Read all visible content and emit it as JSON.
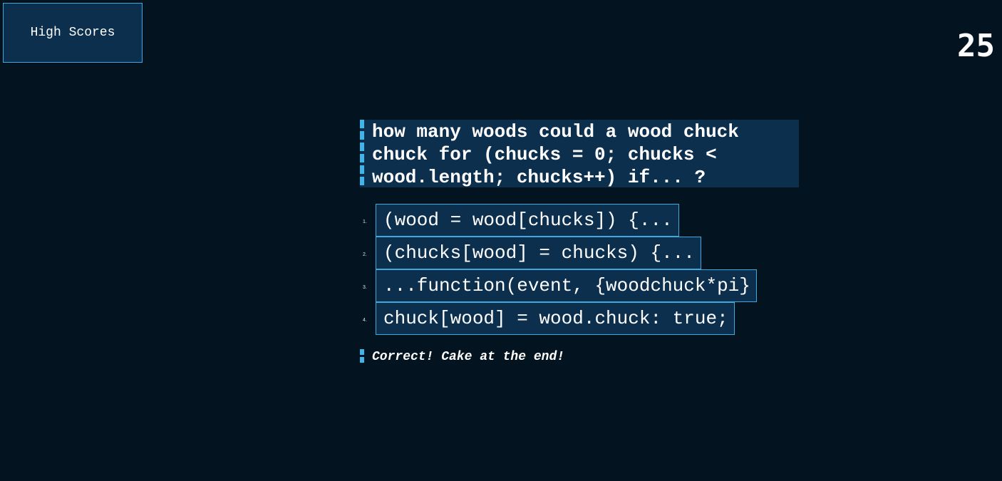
{
  "header": {
    "high_scores_label": "High Scores",
    "score": "25"
  },
  "question": {
    "text": "how many woods could a wood chuck chuck for (chucks = 0; chucks < wood.length; chucks++) if... ?"
  },
  "answers": [
    {
      "number": "1.",
      "text": "(wood = wood[chucks]) {..."
    },
    {
      "number": "2.",
      "text": "(chucks[wood] = chucks) {..."
    },
    {
      "number": "3.",
      "text": "...function(event, {woodchuck*pi}"
    },
    {
      "number": "4.",
      "text": "chuck[wood] = wood.chuck: true;"
    }
  ],
  "feedback": {
    "text": "Correct! Cake at the end!"
  },
  "colors": {
    "background": "#03131f",
    "panel": "#0c2f4e",
    "accent": "#3fb6ea"
  }
}
